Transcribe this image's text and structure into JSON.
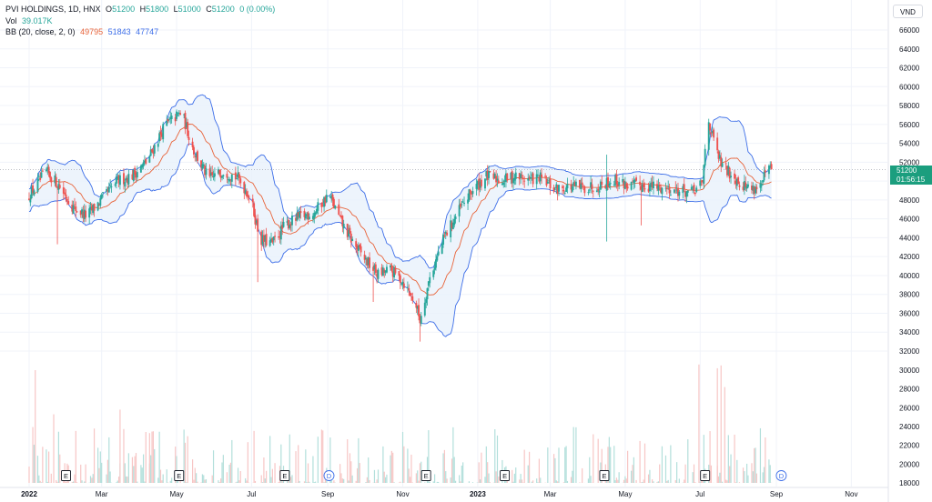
{
  "symbol": {
    "name": "PVI HOLDINGS, 1D, HNX",
    "open_label": "O",
    "open": "51200",
    "high_label": "H",
    "high": "51800",
    "low_label": "L",
    "low": "51000",
    "close_label": "C",
    "close": "51200",
    "change": "0 (0.00%)"
  },
  "volume": {
    "label": "Vol",
    "value": "39.017K"
  },
  "bollinger": {
    "label": "BB (20, close, 2, 0)",
    "basis": "49795",
    "upper": "51843",
    "lower": "47747"
  },
  "currency": "VND",
  "last_price": {
    "price": "51200",
    "countdown": "01:56:15"
  },
  "colors": {
    "up": "#26a69a",
    "down": "#ef5350",
    "basis": "#e8643a",
    "band": "#3d6ee8",
    "band_fill": "#e8f1fb"
  },
  "chart_data": {
    "type": "candlestick",
    "y_axis": {
      "range": [
        32000,
        66000
      ],
      "ticks": [
        66000,
        64000,
        62000,
        60000,
        58000,
        56000,
        54000,
        52000,
        50000,
        48000,
        46000,
        44000,
        42000,
        40000,
        38000,
        36000,
        34000,
        32000
      ]
    },
    "volume_axis": {
      "ticks": [
        30000,
        28000,
        26000,
        24000,
        22000,
        20000,
        18000
      ]
    },
    "x_axis": {
      "ticks": [
        "2022",
        "Mar",
        "May",
        "Jul",
        "Sep",
        "Nov",
        "2023",
        "Mar",
        "May",
        "Jul",
        "Sep",
        "Nov"
      ],
      "tick_days": [
        0,
        59,
        120,
        181,
        243,
        304,
        365,
        424,
        485,
        546,
        608,
        669
      ]
    },
    "close_path": [
      [
        0,
        48500
      ],
      [
        14,
        51000
      ],
      [
        24,
        49600
      ],
      [
        36,
        47200
      ],
      [
        47,
        46300
      ],
      [
        60,
        48200
      ],
      [
        72,
        50000
      ],
      [
        84,
        50600
      ],
      [
        96,
        52100
      ],
      [
        110,
        55800
      ],
      [
        124,
        57300
      ],
      [
        134,
        53200
      ],
      [
        146,
        50200
      ],
      [
        158,
        51100
      ],
      [
        170,
        50300
      ],
      [
        180,
        48300
      ],
      [
        188,
        43800
      ],
      [
        198,
        43400
      ],
      [
        208,
        45300
      ],
      [
        220,
        46200
      ],
      [
        232,
        46700
      ],
      [
        244,
        48600
      ],
      [
        254,
        45600
      ],
      [
        264,
        43400
      ],
      [
        274,
        41600
      ],
      [
        284,
        40100
      ],
      [
        294,
        40600
      ],
      [
        304,
        39400
      ],
      [
        314,
        37200
      ],
      [
        318,
        35300
      ],
      [
        326,
        39800
      ],
      [
        338,
        44100
      ],
      [
        350,
        46900
      ],
      [
        360,
        48900
      ],
      [
        372,
        50500
      ],
      [
        384,
        50100
      ],
      [
        396,
        50500
      ],
      [
        406,
        50200
      ],
      [
        416,
        50300
      ],
      [
        428,
        49100
      ],
      [
        440,
        49400
      ],
      [
        452,
        49300
      ],
      [
        464,
        49600
      ],
      [
        476,
        50100
      ],
      [
        488,
        49500
      ],
      [
        500,
        49600
      ],
      [
        512,
        49300
      ],
      [
        522,
        49200
      ],
      [
        532,
        48900
      ],
      [
        540,
        48800
      ],
      [
        548,
        49700
      ],
      [
        552,
        57000
      ],
      [
        558,
        53600
      ],
      [
        564,
        51500
      ],
      [
        572,
        50700
      ],
      [
        580,
        49700
      ],
      [
        588,
        49200
      ],
      [
        596,
        49600
      ],
      [
        600,
        51100
      ],
      [
        604,
        51200
      ]
    ],
    "spikes": [
      {
        "day": 23,
        "low": 43300
      },
      {
        "day": 186,
        "low": 39300
      },
      {
        "day": 280,
        "low": 37200
      },
      {
        "day": 318,
        "low": 33000
      },
      {
        "day": 470,
        "low": 43600
      },
      {
        "day": 498,
        "low": 45300
      },
      {
        "day": 470,
        "high": 52800
      }
    ],
    "volume_spikes": [
      {
        "day": 5,
        "value": 30000
      },
      {
        "day": 20,
        "value": 25300
      },
      {
        "day": 74,
        "value": 25800
      },
      {
        "day": 98,
        "value": 23300
      },
      {
        "day": 545,
        "value": 30600
      },
      {
        "day": 560,
        "value": 30200
      },
      {
        "day": 563,
        "value": 30500
      },
      {
        "day": 566,
        "value": 28200
      }
    ],
    "events": [
      {
        "type": "E",
        "day": 30
      },
      {
        "type": "E",
        "day": 122
      },
      {
        "type": "E",
        "day": 208
      },
      {
        "type": "D",
        "day": 244
      },
      {
        "type": "E",
        "day": 323
      },
      {
        "type": "E",
        "day": 387
      },
      {
        "type": "E",
        "day": 468
      },
      {
        "type": "E",
        "day": 550
      },
      {
        "type": "D",
        "day": 612
      }
    ]
  }
}
